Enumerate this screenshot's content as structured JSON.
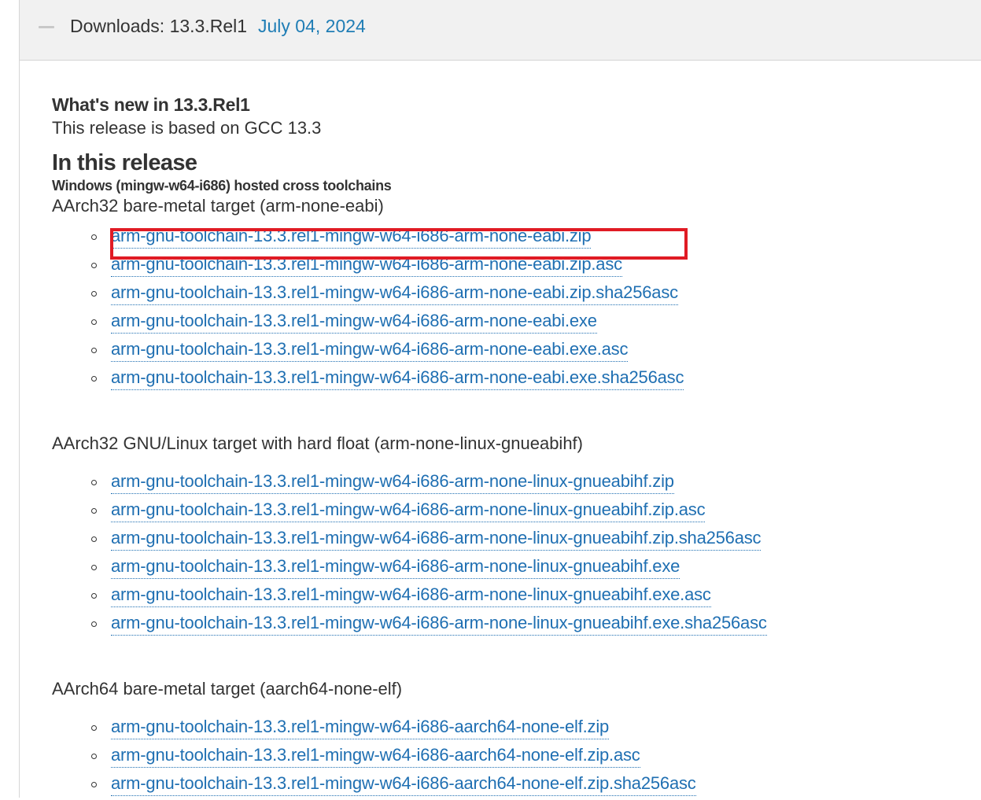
{
  "accordion": {
    "title": "Downloads: 13.3.Rel1",
    "date": "July 04, 2024"
  },
  "intro": {
    "whats_new": "What's new in 13.3.Rel1",
    "based_on": "This release is based on GCC 13.3",
    "in_this_release": "In this release",
    "host_heading": "Windows (mingw-w64-i686) hosted cross toolchains"
  },
  "sections": [
    {
      "title": "AArch32 bare-metal target (arm-none-eabi)",
      "files": [
        "arm-gnu-toolchain-13.3.rel1-mingw-w64-i686-arm-none-eabi.zip",
        "arm-gnu-toolchain-13.3.rel1-mingw-w64-i686-arm-none-eabi.zip.asc",
        "arm-gnu-toolchain-13.3.rel1-mingw-w64-i686-arm-none-eabi.zip.sha256asc",
        "arm-gnu-toolchain-13.3.rel1-mingw-w64-i686-arm-none-eabi.exe",
        "arm-gnu-toolchain-13.3.rel1-mingw-w64-i686-arm-none-eabi.exe.asc",
        "arm-gnu-toolchain-13.3.rel1-mingw-w64-i686-arm-none-eabi.exe.sha256asc"
      ]
    },
    {
      "title": "AArch32 GNU/Linux target with hard float (arm-none-linux-gnueabihf)",
      "files": [
        "arm-gnu-toolchain-13.3.rel1-mingw-w64-i686-arm-none-linux-gnueabihf.zip",
        "arm-gnu-toolchain-13.3.rel1-mingw-w64-i686-arm-none-linux-gnueabihf.zip.asc",
        "arm-gnu-toolchain-13.3.rel1-mingw-w64-i686-arm-none-linux-gnueabihf.zip.sha256asc",
        "arm-gnu-toolchain-13.3.rel1-mingw-w64-i686-arm-none-linux-gnueabihf.exe",
        "arm-gnu-toolchain-13.3.rel1-mingw-w64-i686-arm-none-linux-gnueabihf.exe.asc",
        "arm-gnu-toolchain-13.3.rel1-mingw-w64-i686-arm-none-linux-gnueabihf.exe.sha256asc"
      ]
    },
    {
      "title": "AArch64 bare-metal target (aarch64-none-elf)",
      "files": [
        "arm-gnu-toolchain-13.3.rel1-mingw-w64-i686-aarch64-none-elf.zip",
        "arm-gnu-toolchain-13.3.rel1-mingw-w64-i686-aarch64-none-elf.zip.asc",
        "arm-gnu-toolchain-13.3.rel1-mingw-w64-i686-aarch64-none-elf.zip.sha256asc"
      ]
    }
  ],
  "colors": {
    "link": "#1f6fb2",
    "date": "#1f7db5",
    "highlight": "#e01b24",
    "header_bg": "#f1f1f1"
  }
}
